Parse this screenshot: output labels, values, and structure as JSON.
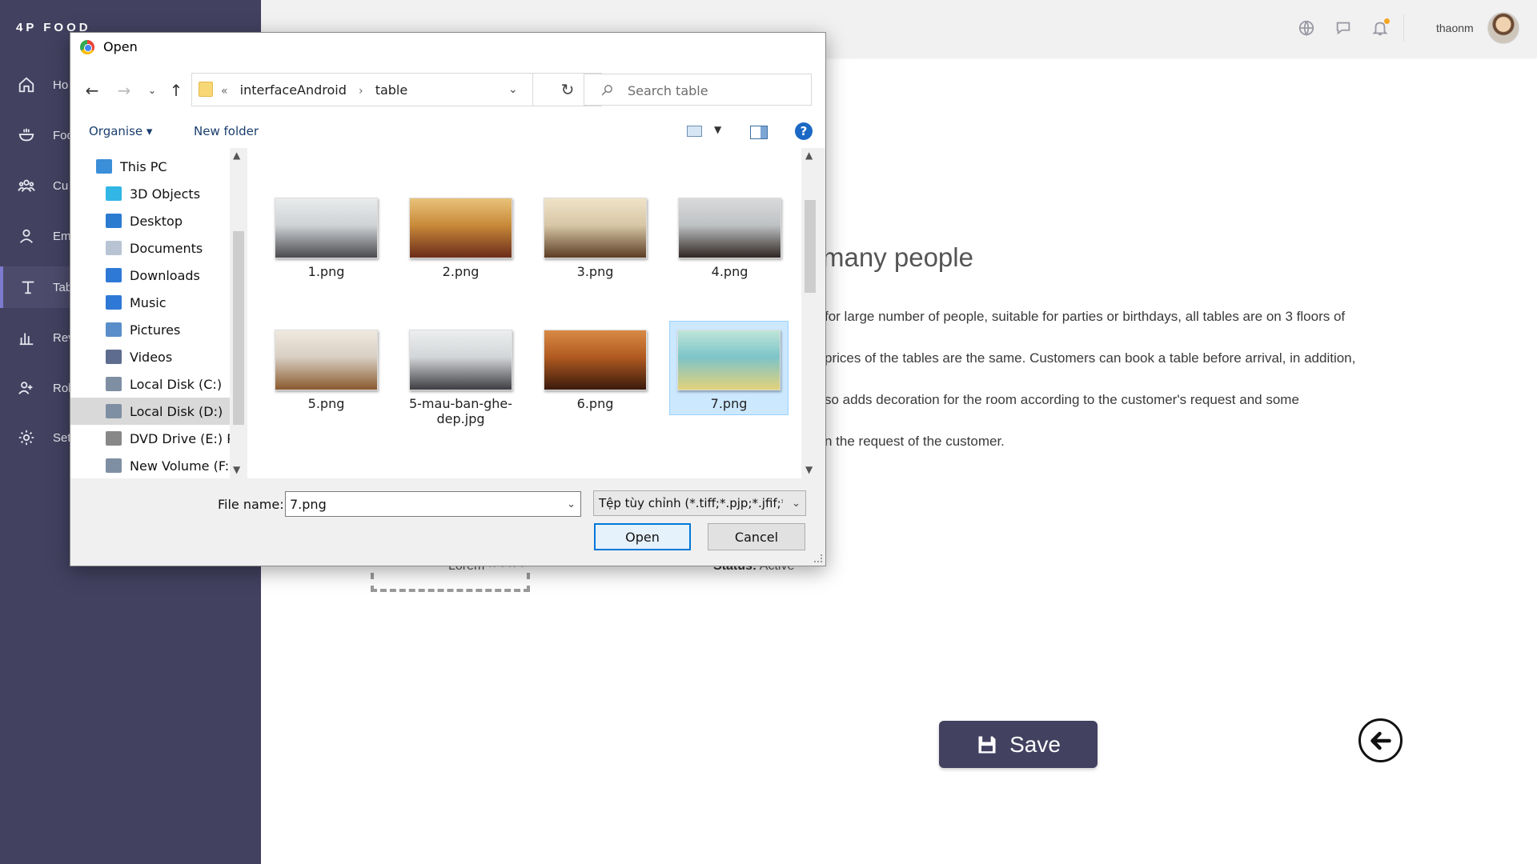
{
  "app": {
    "brand": "4P FOOD",
    "nav": [
      {
        "label": "Ho",
        "icon": "home-icon"
      },
      {
        "label": "Foo",
        "icon": "bowl-icon"
      },
      {
        "label": "Cu",
        "icon": "customers-icon"
      },
      {
        "label": "Em",
        "icon": "employee-icon"
      },
      {
        "label": "Tab",
        "icon": "table-icon",
        "active": true
      },
      {
        "label": "Rev",
        "icon": "chart-icon"
      },
      {
        "label": "Rol",
        "icon": "role-icon"
      },
      {
        "label": "Set",
        "icon": "gear-icon"
      }
    ],
    "header": {
      "username": "thaonm",
      "icons": [
        "globe-icon",
        "chat-icon",
        "bell-icon"
      ],
      "notification_color": "#f5a623"
    },
    "accent_color": "#424160"
  },
  "page": {
    "heading": "many people",
    "description": [
      "for large number of people, suitable for parties or birthdays, all tables are on 3 floors  of",
      "prices of the tables are the same. Customers can book a table before  arrival, in addition,",
      "so adds  decoration  for the   room according  to the customer's request and some",
      "n the request of the customer."
    ],
    "status_label": "Status:",
    "status_value": "Active",
    "partial_label": "Lorem ·· · ·· ·",
    "save_label": "Save"
  },
  "dialog": {
    "title": "Open",
    "breadcrumb": [
      "interfaceAndroid",
      "table"
    ],
    "breadcrumb_prefix": "«",
    "search_placeholder": "Search table",
    "organise_label": "Organise ▾",
    "new_folder_label": "New folder",
    "help_label": "?",
    "tree": [
      {
        "label": "This PC",
        "icon": "pc-icon",
        "color": "#3b8ed8",
        "indent": 1
      },
      {
        "label": "3D Objects",
        "icon": "cube-icon",
        "color": "#31b6e6",
        "indent": 2
      },
      {
        "label": "Desktop",
        "icon": "desktop-icon",
        "color": "#2b7bd1",
        "indent": 2
      },
      {
        "label": "Documents",
        "icon": "document-icon",
        "color": "#b8c4d4",
        "indent": 2
      },
      {
        "label": "Downloads",
        "icon": "download-icon",
        "color": "#2f79d6",
        "indent": 2
      },
      {
        "label": "Music",
        "icon": "music-icon",
        "color": "#2f79d6",
        "indent": 2
      },
      {
        "label": "Pictures",
        "icon": "pictures-icon",
        "color": "#5a8ec9",
        "indent": 2
      },
      {
        "label": "Videos",
        "icon": "videos-icon",
        "color": "#5e6d8f",
        "indent": 2
      },
      {
        "label": "Local Disk (C:)",
        "icon": "disk-c-icon",
        "color": "#7f8fa3",
        "indent": 2
      },
      {
        "label": "Local Disk (D:)",
        "icon": "disk-d-icon",
        "color": "#7f8fa3",
        "indent": 2,
        "selected": true
      },
      {
        "label": "DVD Drive (E:) PF",
        "icon": "dvd-icon",
        "color": "#888888",
        "indent": 2
      },
      {
        "label": "New Volume (F:)",
        "icon": "volume-icon",
        "color": "#7f8fa3",
        "indent": 2
      }
    ],
    "files": [
      {
        "name": "1.png",
        "colors": [
          "#cfd3d6",
          "#4a4a4f",
          "#e9ebec"
        ]
      },
      {
        "name": "2.png",
        "colors": [
          "#c98a3a",
          "#6b2c1a",
          "#e8c27a"
        ]
      },
      {
        "name": "3.png",
        "colors": [
          "#d8c7a6",
          "#5c3d24",
          "#efe3c8"
        ]
      },
      {
        "name": "4.png",
        "colors": [
          "#bfc2c4",
          "#2e2623",
          "#d9dadb"
        ]
      },
      {
        "name": "5.png",
        "colors": [
          "#d9cfc3",
          "#8a5a2e",
          "#f0e9df"
        ]
      },
      {
        "name": "5-mau-ban-ghe-dep.jpg",
        "colors": [
          "#d3d6d8",
          "#3d3d42",
          "#eceeef"
        ]
      },
      {
        "name": "6.png",
        "colors": [
          "#b05a20",
          "#3a1a0d",
          "#d98a46"
        ]
      },
      {
        "name": "7.png",
        "colors": [
          "#7cc4c9",
          "#e3d27a",
          "#bfe6d8"
        ],
        "selected": true
      }
    ],
    "file_name_label": "File name:",
    "file_name_value": "7.png",
    "filter_value": "Tệp tùy chỉnh (*.tiff;*.pjp;*.jfif;*",
    "open_label": "Open",
    "cancel_label": "Cancel"
  }
}
